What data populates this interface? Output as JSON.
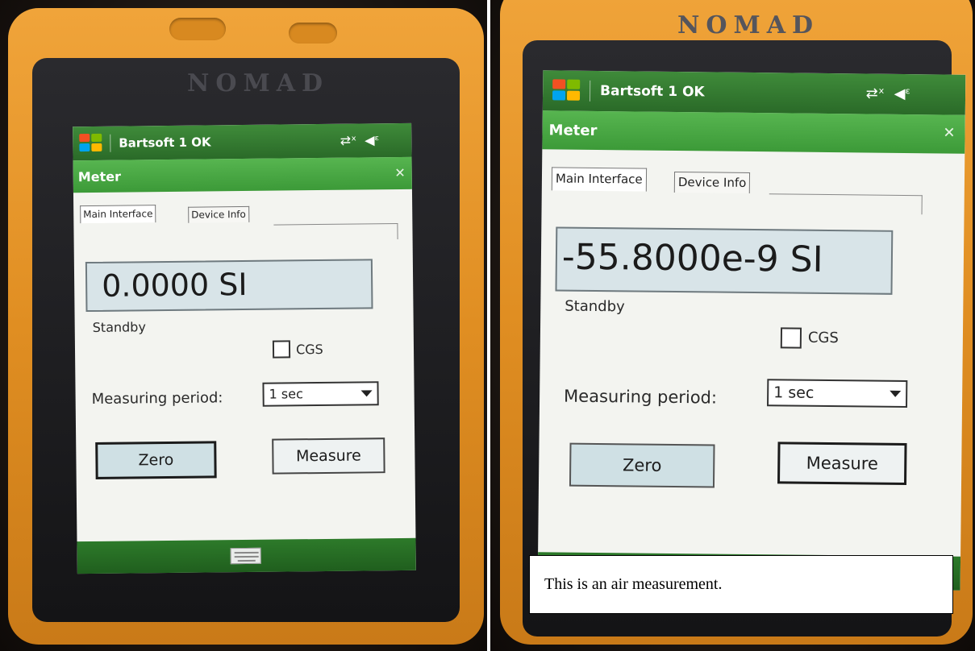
{
  "left_device": {
    "brand": "NOMAD",
    "status_title": "Bartsoft 1 OK",
    "window_title": "Meter",
    "close_label": "✕",
    "tabs": [
      {
        "label": "Main Interface",
        "active": true
      },
      {
        "label": "Device Info",
        "active": false
      }
    ],
    "reading": "0.0000 SI",
    "status_text": "Standby",
    "cgs_label": "CGS",
    "cgs_checked": false,
    "period_label": "Measuring period:",
    "period_value": "1 sec",
    "zero_label": "Zero",
    "measure_label": "Measure"
  },
  "right_device": {
    "brand": "NOMAD",
    "status_title": "Bartsoft 1 OK",
    "window_title": "Meter",
    "close_label": "✕",
    "tabs": [
      {
        "label": "Main Interface",
        "active": true
      },
      {
        "label": "Device Info",
        "active": false
      }
    ],
    "reading": "-55.8000e-9 SI",
    "status_text": "Standby",
    "cgs_label": "CGS",
    "cgs_checked": false,
    "period_label": "Measuring period:",
    "period_value": "1 sec",
    "zero_label": "Zero",
    "measure_label": "Measure"
  },
  "caption": "This is an air measurement.",
  "colors": {
    "case_orange": "#e08e22",
    "status_green": "#2a6a28",
    "title_green": "#3c9a38",
    "readout_bg": "#d8e4e8",
    "zero_button_bg": "#cfe0e4"
  },
  "icons": [
    "windows-logo-icon",
    "connectivity-icon",
    "speaker-icon",
    "close-icon",
    "dropdown-arrow-icon",
    "keyboard-icon"
  ]
}
